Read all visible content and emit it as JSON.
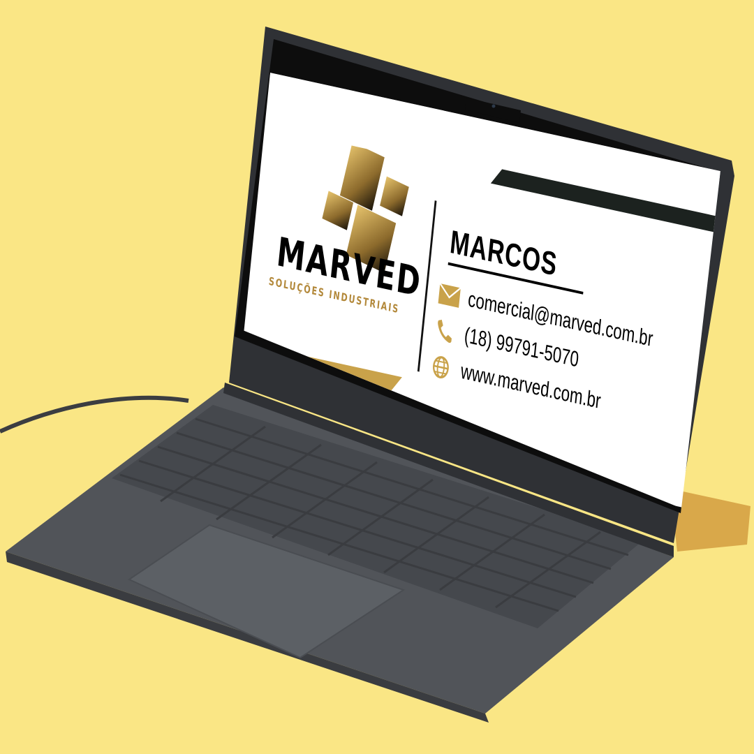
{
  "colors": {
    "background": "#fae685",
    "laptop_body": "#515459",
    "bezel": "#111111",
    "gold": "#c9a24a",
    "card_background": "#ffffff",
    "card_text": "#000000"
  },
  "business_card": {
    "brand": {
      "name": "MARVED",
      "tagline": "SOLUÇÕES INDUSTRIAIS"
    },
    "person_name": "MARCOS",
    "contacts": [
      {
        "icon": "envelope-icon",
        "text": "comercial@marved.com.br"
      },
      {
        "icon": "phone-icon",
        "text": "(18) 99791-5070"
      },
      {
        "icon": "globe-icon",
        "text": "www.marved.com.br"
      }
    ]
  }
}
